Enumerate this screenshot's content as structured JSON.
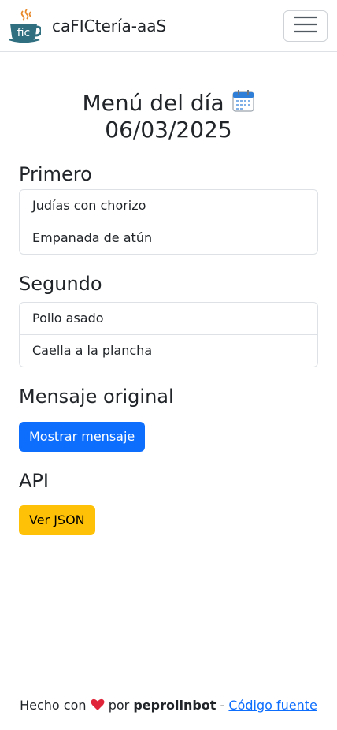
{
  "brand": {
    "logo_text": "fic",
    "name": "caFICtería-aaS"
  },
  "navbar": {
    "toggle_icon": "hamburger-icon"
  },
  "menu": {
    "title_line1": "Menú del día",
    "date": "06/03/2025",
    "calendar_icon": "calendar-icon"
  },
  "sections": {
    "primero": {
      "heading": "Primero",
      "items": [
        "Judías con chorizo",
        "Empanada de atún"
      ]
    },
    "segundo": {
      "heading": "Segundo",
      "items": [
        "Pollo asado",
        "Caella a la plancha"
      ]
    },
    "mensaje": {
      "heading": "Mensaje original",
      "button_label": "Mostrar mensaje"
    },
    "api": {
      "heading": "API",
      "button_label": "Ver JSON"
    }
  },
  "footer": {
    "made_with": "Hecho con",
    "heart_icon": "heart-icon",
    "por": "por",
    "author": "peprolinbot",
    "separator": "-",
    "source_link": "Código fuente"
  },
  "colors": {
    "primary": "#0d6efd",
    "warning": "#ffc107",
    "logo_teal": "#2f6f80",
    "logo_steam": "#e8892b",
    "heart": "#e0243a"
  }
}
